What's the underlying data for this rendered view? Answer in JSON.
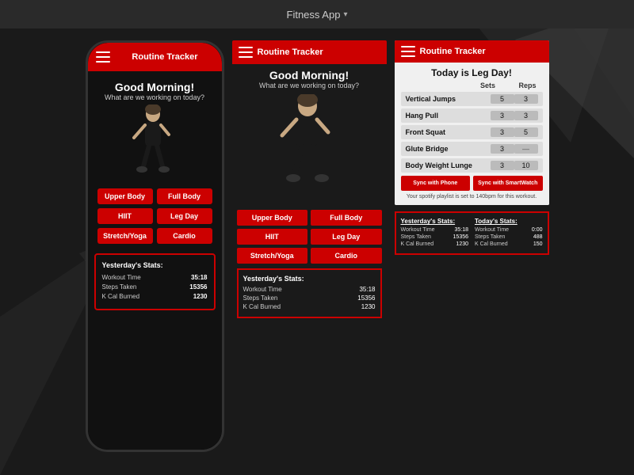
{
  "topBar": {
    "title": "Fitness App",
    "chevron": "▾"
  },
  "phone": {
    "header": {
      "title": "Routine Tracker"
    },
    "greeting": "Good Morning!",
    "subtitle": "What are we working on today?",
    "workoutButtons": [
      {
        "label": "Upper Body"
      },
      {
        "label": "Full Body"
      },
      {
        "label": "HIIT"
      },
      {
        "label": "Leg Day"
      },
      {
        "label": "Stretch/Yoga"
      },
      {
        "label": "Cardio"
      }
    ],
    "stats": {
      "title": "Yesterday's Stats:",
      "rows": [
        {
          "label": "Workout Time",
          "value": "35:18"
        },
        {
          "label": "Steps Taken",
          "value": "15356"
        },
        {
          "label": "K Cal Burned",
          "value": "1230"
        }
      ]
    }
  },
  "middlePanel": {
    "header": {
      "title": "Routine Tracker"
    },
    "greeting": "Good Morning!",
    "subtitle": "What are we working on today?",
    "workoutButtons": [
      {
        "label": "Upper Body"
      },
      {
        "label": "Full Body"
      },
      {
        "label": "HIIT"
      },
      {
        "label": "Leg Day"
      },
      {
        "label": "Stretch/Yoga"
      },
      {
        "label": "Cardio"
      }
    ],
    "stats": {
      "title": "Yesterday's Stats:",
      "rows": [
        {
          "label": "Workout Time",
          "value": "35:18"
        },
        {
          "label": "Steps Taken",
          "value": "15356"
        },
        {
          "label": "K Cal Burned",
          "value": "1230"
        }
      ]
    }
  },
  "rightPanel": {
    "tracker": {
      "header": {
        "title": "Routine Tracker"
      },
      "dayTitle": "Today is Leg Day!",
      "columns": [
        "Sets",
        "Reps"
      ],
      "exercises": [
        {
          "name": "Vertical Jumps",
          "sets": "5",
          "reps": "3"
        },
        {
          "name": "Hang Pull",
          "sets": "3",
          "reps": "3"
        },
        {
          "name": "Front Squat",
          "sets": "3",
          "reps": "5"
        },
        {
          "name": "Glute Bridge",
          "sets": "3",
          "reps": "—"
        },
        {
          "name": "Body Weight Lunge",
          "sets": "3",
          "reps": "10"
        }
      ],
      "syncButtons": [
        {
          "label": "Sync with Phone"
        },
        {
          "label": "Sync with SmartWatch"
        }
      ],
      "spotifyNotice": "Your spotify playlist is set to 140bpm for this workout."
    },
    "bottomStats": {
      "yesterday": {
        "title": "Yesterday's Stats:",
        "rows": [
          {
            "label": "Workout Time",
            "value": "35:18"
          },
          {
            "label": "Steps Taken",
            "value": "15356"
          },
          {
            "label": "K Cal Burned",
            "value": "1230"
          }
        ]
      },
      "today": {
        "title": "Today's Stats:",
        "rows": [
          {
            "label": "Workout Time",
            "value": "0:00"
          },
          {
            "label": "Steps Taken",
            "value": "488"
          },
          {
            "label": "K Cal Burned",
            "value": "150"
          }
        ]
      }
    }
  }
}
